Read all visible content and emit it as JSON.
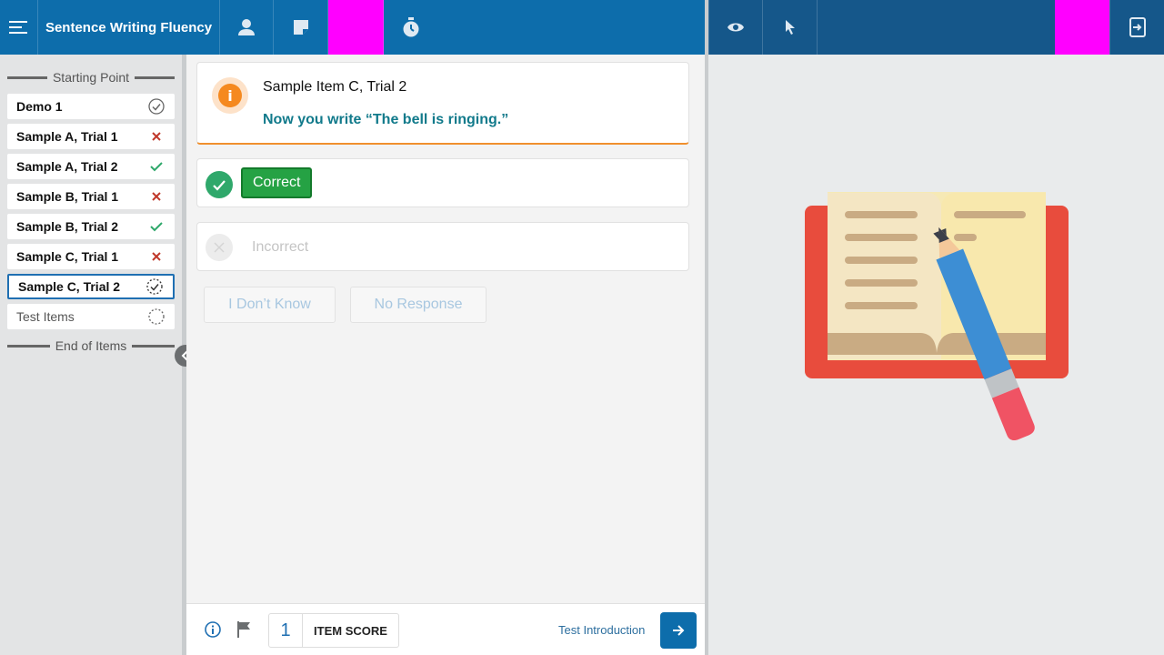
{
  "app": {
    "title": "Sentence Writing Fluency"
  },
  "toolbar_left": {
    "icons": [
      "menu-icon",
      "examinee-icon",
      "notes-icon",
      "timer-icon"
    ]
  },
  "toolbar_right": {
    "icons": [
      "eye-icon",
      "pointer-icon",
      "swap-screen-icon"
    ]
  },
  "sidebar": {
    "start_label": "Starting Point",
    "end_label": "End of Items",
    "items": [
      {
        "label": "Demo 1",
        "status": "done"
      },
      {
        "label": "Sample A, Trial 1",
        "status": "incorrect"
      },
      {
        "label": "Sample A, Trial 2",
        "status": "correct"
      },
      {
        "label": "Sample B, Trial 1",
        "status": "incorrect"
      },
      {
        "label": "Sample B, Trial 2",
        "status": "correct"
      },
      {
        "label": "Sample C, Trial 1",
        "status": "incorrect"
      },
      {
        "label": "Sample C, Trial 2",
        "status": "current"
      },
      {
        "label": "Test Items",
        "status": "pending"
      }
    ]
  },
  "prompt": {
    "title": "Sample Item C, Trial 2",
    "instruction": "Now you write “The bell is ringing.”"
  },
  "responses": {
    "correct_label": "Correct",
    "incorrect_label": "Incorrect",
    "dont_know_label": "I Don’t Know",
    "no_response_label": "No Response"
  },
  "footer": {
    "score_value": "1",
    "score_label": "ITEM SCORE",
    "next_label": "Test Introduction"
  },
  "colors": {
    "primary": "#0d6dab",
    "correct": "#25a244",
    "incorrect": "#c0392b",
    "warning": "#f5891f"
  }
}
